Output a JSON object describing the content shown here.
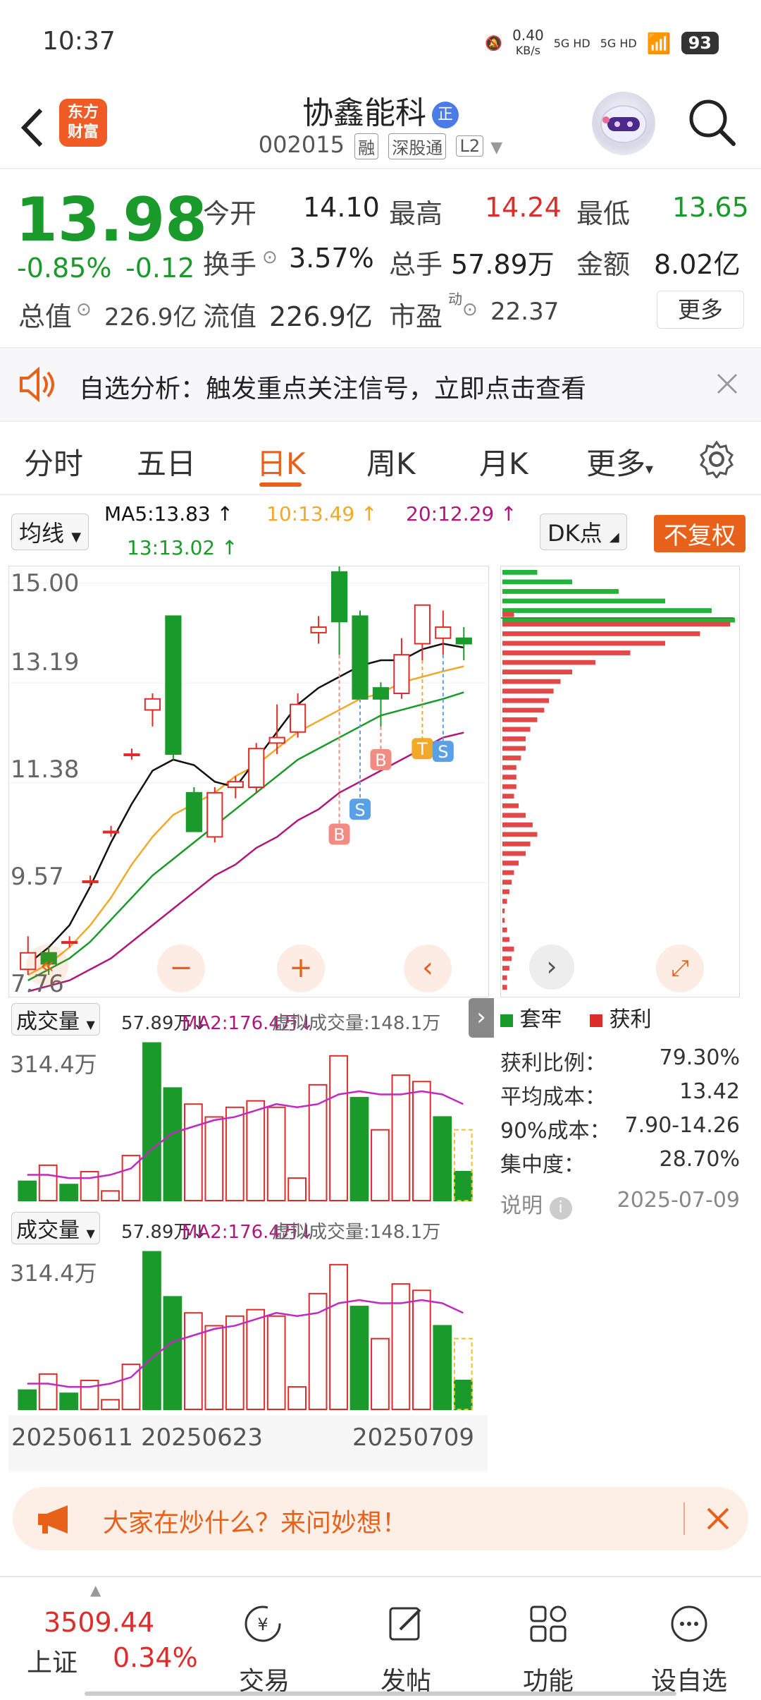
{
  "status_bar": {
    "time": "10:37",
    "net_speed": "0.40",
    "net_unit": "KB/s",
    "sig1": "5G HD",
    "sig2": "5G HD",
    "battery": "93"
  },
  "header": {
    "logo_line1": "东方",
    "logo_line2": "财富",
    "name": "协鑫能科",
    "badge": "正",
    "code": "002015",
    "tags": [
      "融",
      "深股通",
      "L2"
    ]
  },
  "quote": {
    "price": "13.98",
    "change_pct": "-0.85%",
    "change": "-0.12",
    "open_label": "今开",
    "open": "14.10",
    "high_label": "最高",
    "high": "14.24",
    "low_label": "最低",
    "low": "13.65",
    "turnover_label": "换手",
    "turnover": "3.57%",
    "volume_label": "总手",
    "volume": "57.89万",
    "amount_label": "金额",
    "amount": "8.02亿",
    "mcap_label": "总值",
    "mcap": "226.9亿",
    "float_label": "流值",
    "float": "226.9亿",
    "pe_label": "市盈",
    "pe_sup": "动",
    "pe": "22.37",
    "more": "更多"
  },
  "banner": {
    "text": "自选分析：触发重点关注信号，立即点击查看"
  },
  "tabs": [
    "分时",
    "五日",
    "日K",
    "周K",
    "月K",
    "更多"
  ],
  "ma": {
    "type": "均线",
    "ma5": "MA5:13.83",
    "ma10": "10:13.49",
    "ma20": "20:12.29",
    "ma13": "13:13.02",
    "dk": "DK点",
    "fuquan": "不复权"
  },
  "colors": {
    "red": "#e02b2b",
    "green": "#1a9a2a",
    "orange": "#e8611a",
    "ma5": "#111111",
    "ma10": "#f0a92a",
    "ma20": "#b0177a",
    "ma13": "#1a9a2a"
  },
  "price_axis": [
    "15.00",
    "13.19",
    "11.38",
    "9.57",
    "7.76"
  ],
  "vol_header": {
    "label": "成交量",
    "vol": "57.89万",
    "ma2": "MA2:176.4万",
    "virtual": "虚拟成交量:148.1万"
  },
  "vol_axis": "314.4万",
  "dates": [
    "20250611",
    "20250623",
    "20250709"
  ],
  "signals": [
    "B",
    "S",
    "B",
    "T",
    "S"
  ],
  "chip": {
    "legend_trap": "套牢",
    "legend_profit": "获利",
    "rows": [
      {
        "label": "获利比例：",
        "value": "79.30%"
      },
      {
        "label": "平均成本：",
        "value": "13.42"
      },
      {
        "label": "90%成本：",
        "value": "7.90-14.26"
      },
      {
        "label": "集中度：",
        "value": "28.70%"
      }
    ],
    "note_label": "说明",
    "date": "2025-07-09"
  },
  "bottom_tip": {
    "text": "大家在炒什么？来问妙想！"
  },
  "index": {
    "value": "3509.44",
    "name": "上证",
    "pct": "0.34%"
  },
  "nav": [
    "交易",
    "发帖",
    "功能",
    "设自选"
  ],
  "chart_data": {
    "type": "candlestick",
    "candles": [
      {
        "o": 8.0,
        "c": 8.3,
        "h": 8.6,
        "l": 7.9
      },
      {
        "o": 8.3,
        "c": 8.1,
        "h": 8.4,
        "l": 7.9
      },
      {
        "o": 8.5,
        "c": 8.5,
        "h": 8.6,
        "l": 8.4
      },
      {
        "o": 9.6,
        "c": 9.6,
        "h": 9.7,
        "l": 9.5
      },
      {
        "o": 10.5,
        "c": 10.5,
        "h": 10.6,
        "l": 10.4
      },
      {
        "o": 11.9,
        "c": 11.9,
        "h": 12.0,
        "l": 11.8
      },
      {
        "o": 12.7,
        "c": 12.9,
        "h": 13.0,
        "l": 12.4
      },
      {
        "o": 14.4,
        "c": 11.9,
        "h": 14.4,
        "l": 11.8
      },
      {
        "o": 11.2,
        "c": 10.5,
        "h": 11.3,
        "l": 10.5
      },
      {
        "o": 10.4,
        "c": 11.2,
        "h": 11.3,
        "l": 10.3
      },
      {
        "o": 11.3,
        "c": 11.4,
        "h": 11.5,
        "l": 11.1
      },
      {
        "o": 11.3,
        "c": 12.0,
        "h": 12.1,
        "l": 11.2
      },
      {
        "o": 12.1,
        "c": 12.2,
        "h": 12.8,
        "l": 11.9
      },
      {
        "o": 12.3,
        "c": 12.8,
        "h": 13.0,
        "l": 12.2
      },
      {
        "o": 14.1,
        "c": 14.2,
        "h": 14.4,
        "l": 13.9
      },
      {
        "o": 15.2,
        "c": 14.3,
        "h": 15.3,
        "l": 13.7
      },
      {
        "o": 14.4,
        "c": 12.9,
        "h": 14.5,
        "l": 12.9
      },
      {
        "o": 13.1,
        "c": 12.9,
        "h": 13.2,
        "l": 12.4
      },
      {
        "o": 13.0,
        "c": 13.7,
        "h": 14.0,
        "l": 12.9
      },
      {
        "o": 13.9,
        "c": 14.6,
        "h": 14.6,
        "l": 13.6
      },
      {
        "o": 14.0,
        "c": 14.2,
        "h": 14.5,
        "l": 13.7
      },
      {
        "o": 14.0,
        "c": 13.9,
        "h": 14.2,
        "l": 13.6
      }
    ],
    "ylim": [
      7.76,
      15.3
    ],
    "volumes": [
      0.6,
      1.1,
      0.5,
      0.9,
      0.3,
      1.4,
      4.9,
      3.5,
      3.0,
      2.6,
      2.9,
      3.1,
      2.9,
      0.7,
      3.6,
      4.5,
      3.2,
      2.2,
      3.9,
      3.7,
      2.6,
      0.9
    ],
    "vol_up": [
      false,
      true,
      false,
      true,
      true,
      true,
      false,
      false,
      true,
      true,
      true,
      true,
      true,
      true,
      true,
      true,
      false,
      true,
      true,
      true,
      false,
      false
    ],
    "vol_ylim": [
      0,
      5.0
    ],
    "ma5": [
      8.1,
      8.4,
      8.8,
      9.5,
      10.3,
      11.0,
      11.6,
      11.8,
      11.7,
      11.4,
      11.3,
      11.8,
      12.3,
      12.8,
      13.1,
      13.3,
      13.5,
      13.6,
      13.6,
      13.8,
      13.9,
      13.83
    ],
    "ma10": [
      7.9,
      8.1,
      8.4,
      8.8,
      9.3,
      9.9,
      10.4,
      10.8,
      11.0,
      11.2,
      11.5,
      11.7,
      12.0,
      12.3,
      12.5,
      12.7,
      12.9,
      13.0,
      13.2,
      13.3,
      13.4,
      13.49
    ],
    "ma13": [
      7.8,
      8.0,
      8.2,
      8.5,
      8.9,
      9.3,
      9.7,
      10.0,
      10.3,
      10.6,
      10.9,
      11.2,
      11.5,
      11.8,
      12.0,
      12.2,
      12.4,
      12.6,
      12.7,
      12.8,
      12.9,
      13.02
    ],
    "ma20": [
      7.6,
      7.7,
      7.8,
      8.0,
      8.2,
      8.5,
      8.8,
      9.1,
      9.4,
      9.7,
      9.9,
      10.2,
      10.4,
      10.7,
      10.9,
      11.2,
      11.4,
      11.6,
      11.8,
      12.0,
      12.2,
      12.29
    ],
    "vol_ma": [
      0.8,
      0.8,
      0.7,
      0.7,
      0.8,
      1.0,
      1.6,
      2.1,
      2.3,
      2.5,
      2.6,
      2.8,
      3.0,
      2.9,
      3.0,
      3.3,
      3.4,
      3.3,
      3.3,
      3.4,
      3.3,
      3.0
    ],
    "chip_profit": [
      0.0,
      0.0,
      0.0,
      0.0,
      0.05,
      0.98,
      0.85,
      0.7,
      0.55,
      0.4,
      0.3,
      0.25,
      0.22,
      0.2,
      0.18,
      0.15,
      0.12,
      0.1,
      0.1,
      0.08,
      0.06,
      0.06,
      0.06,
      0.05,
      0.07,
      0.1,
      0.13,
      0.15,
      0.12,
      0.1,
      0.07,
      0.05,
      0.04,
      0.03,
      0.02,
      0.01,
      0.01,
      0.02,
      0.03,
      0.05,
      0.04,
      0.03,
      0.02,
      0.02
    ],
    "chip_trap": [
      0.15,
      0.3,
      0.5,
      0.7,
      0.9,
      1.0,
      0,
      0,
      0,
      0,
      0,
      0,
      0,
      0,
      0,
      0,
      0,
      0,
      0,
      0,
      0,
      0,
      0,
      0,
      0,
      0,
      0,
      0,
      0,
      0,
      0,
      0,
      0,
      0,
      0,
      0,
      0,
      0,
      0,
      0,
      0,
      0,
      0,
      0
    ]
  }
}
